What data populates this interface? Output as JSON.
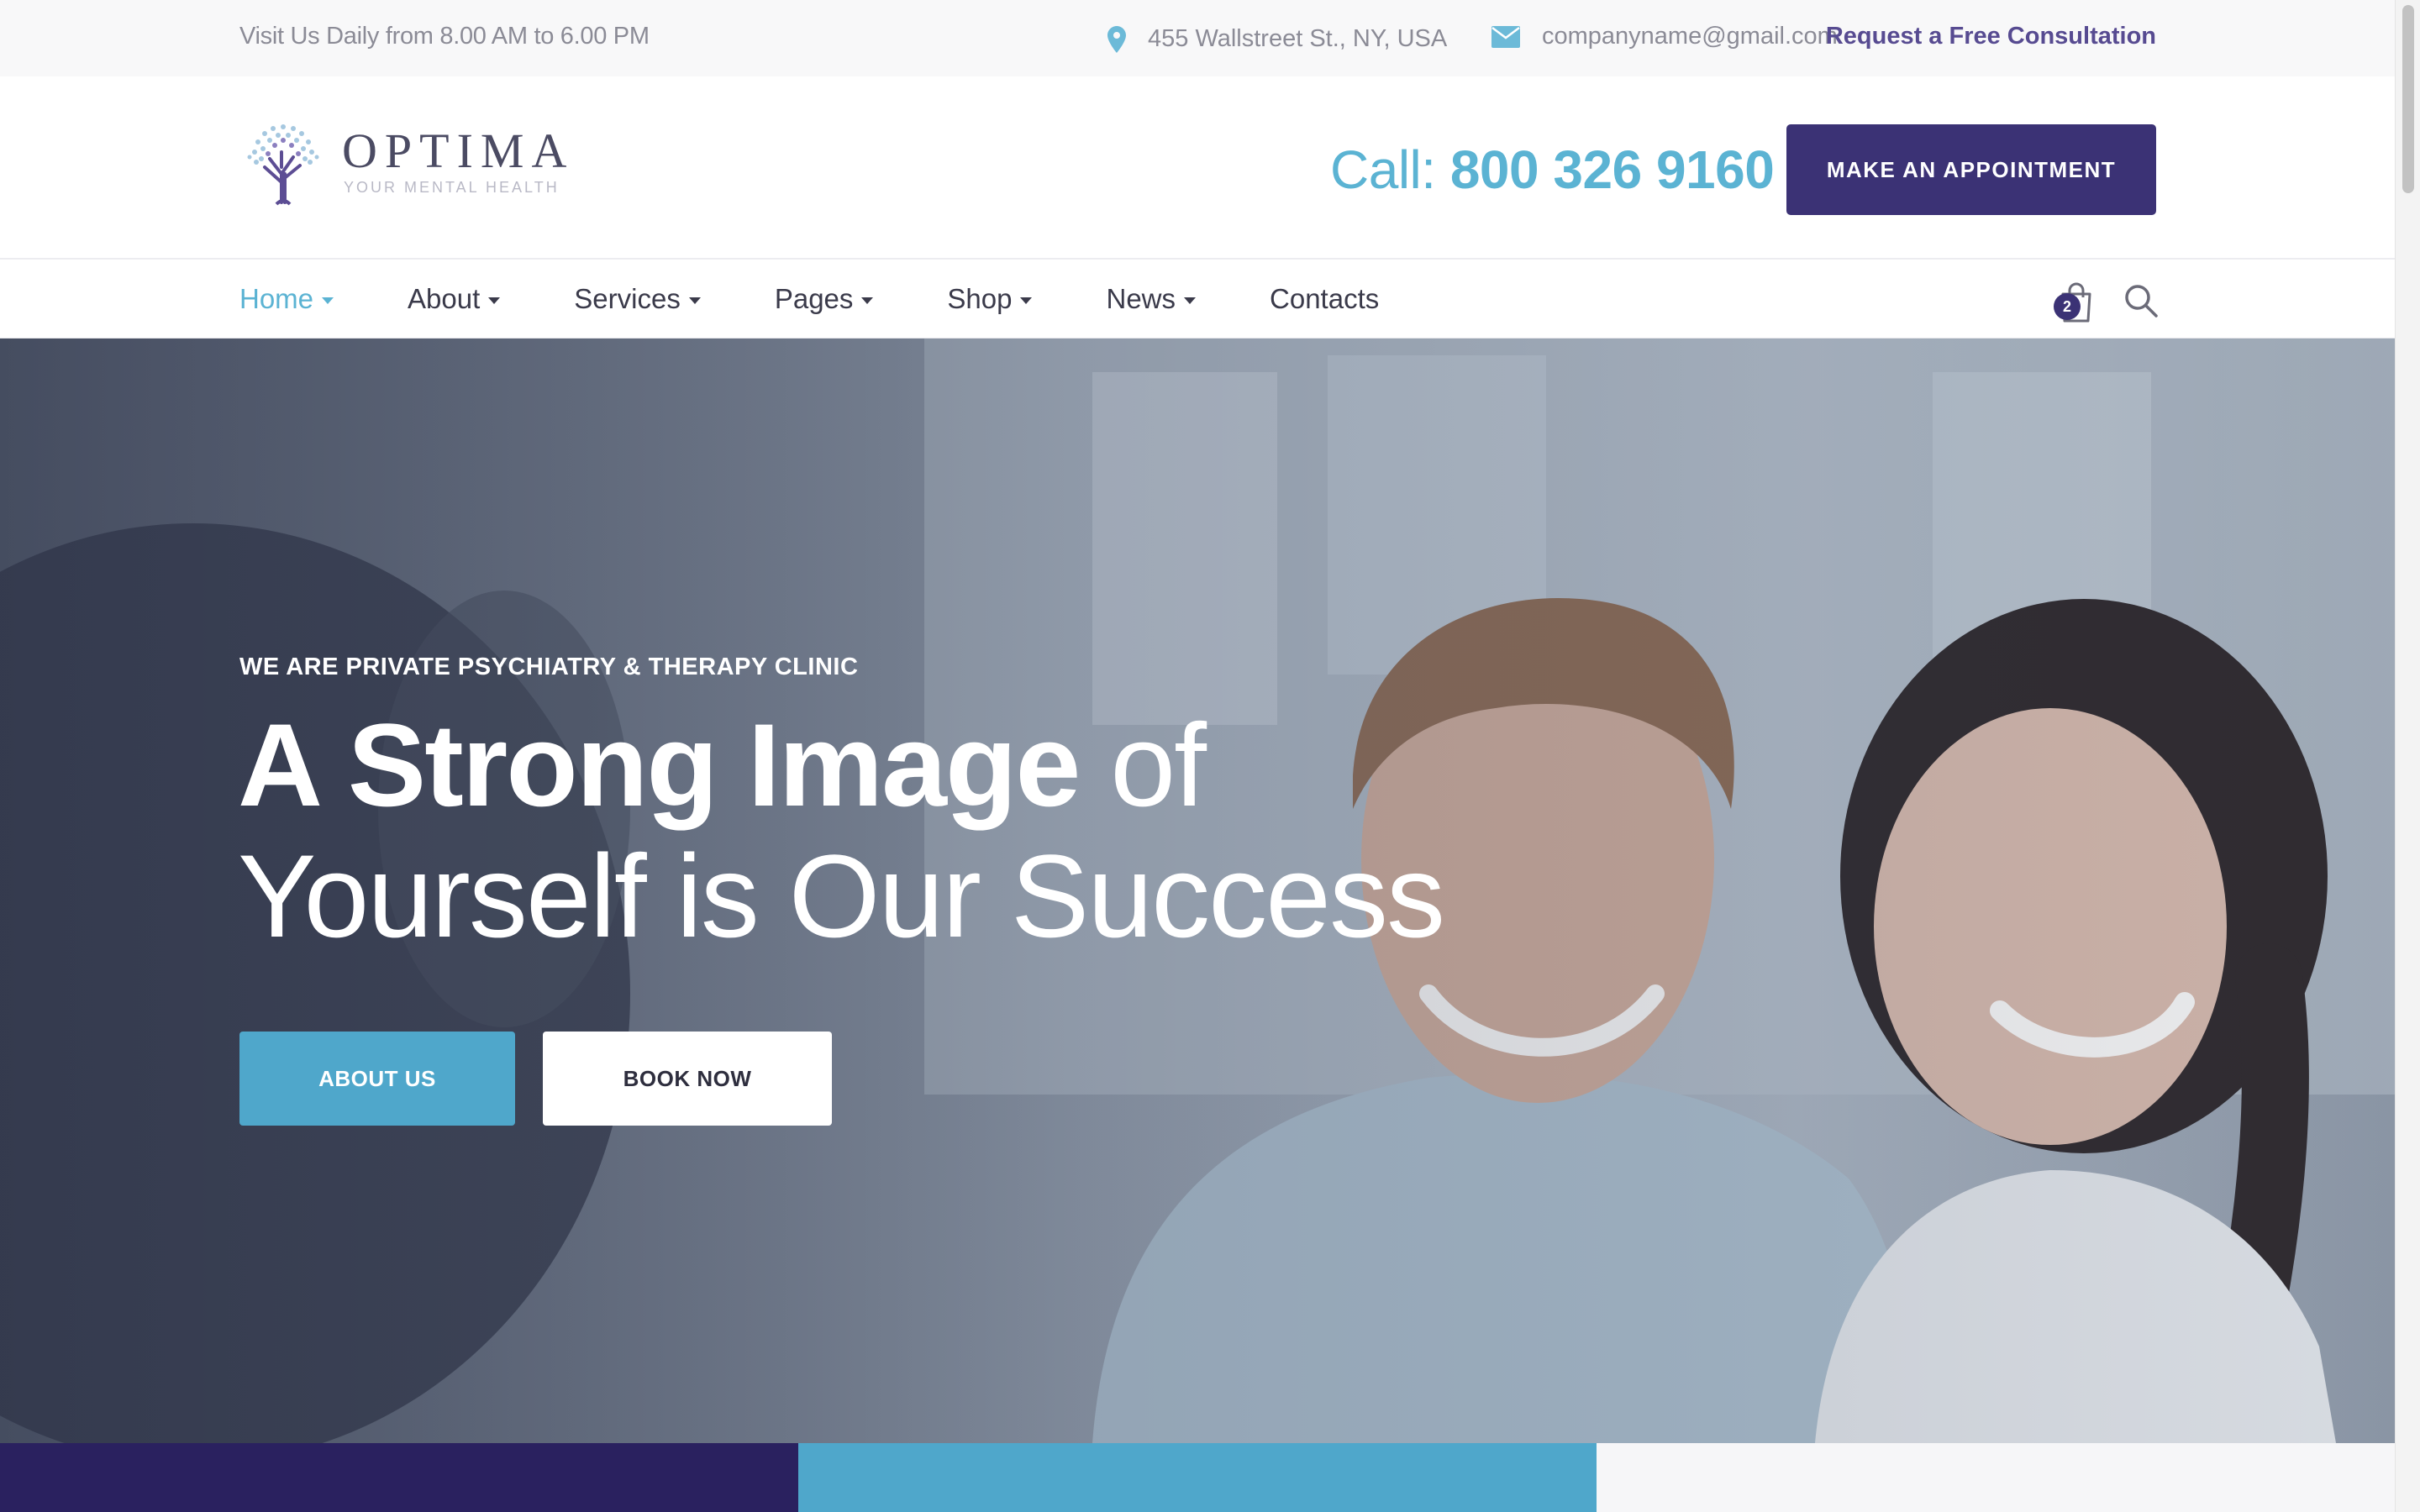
{
  "topbar": {
    "hours": "Visit Us Daily from 8.00 AM to 6.00 PM",
    "address": "455 Wallstreet St., NY, USA",
    "email": "companyname@gmail.com",
    "consultation_link": "Request a Free Consultation",
    "icons": {
      "address": "map-pin-icon",
      "email": "envelope-icon"
    }
  },
  "header": {
    "logo_name": "OPTIMA",
    "logo_tagline": "YOUR MENTAL HEALTH",
    "call_label": "Call:",
    "phone": "800 326 9160",
    "appointment_button": "MAKE AN APPOINTMENT"
  },
  "nav": {
    "items": [
      {
        "label": "Home",
        "active": true,
        "dropdown": true
      },
      {
        "label": "About",
        "dropdown": true
      },
      {
        "label": "Services",
        "dropdown": true
      },
      {
        "label": "Pages",
        "dropdown": true
      },
      {
        "label": "Shop",
        "dropdown": true
      },
      {
        "label": "News",
        "dropdown": true
      },
      {
        "label": "Contacts",
        "dropdown": false
      }
    ],
    "cart_count": "2",
    "icons": {
      "cart": "shopping-bag-icon",
      "search": "search-icon"
    }
  },
  "hero": {
    "eyebrow": "WE ARE PRIVATE PSYCHIATRY & THERAPY CLINIC",
    "headline_bold": "A Strong Image",
    "headline_light_1": " of",
    "headline_light_2": "Yourself is Our Success",
    "about_button": "ABOUT US",
    "book_button": "BOOK NOW"
  },
  "colors": {
    "accent_blue": "#5bb3d3",
    "brand_purple": "#3b3275",
    "dark_purple": "#2a215f",
    "button_blue": "#4fa7cb"
  }
}
